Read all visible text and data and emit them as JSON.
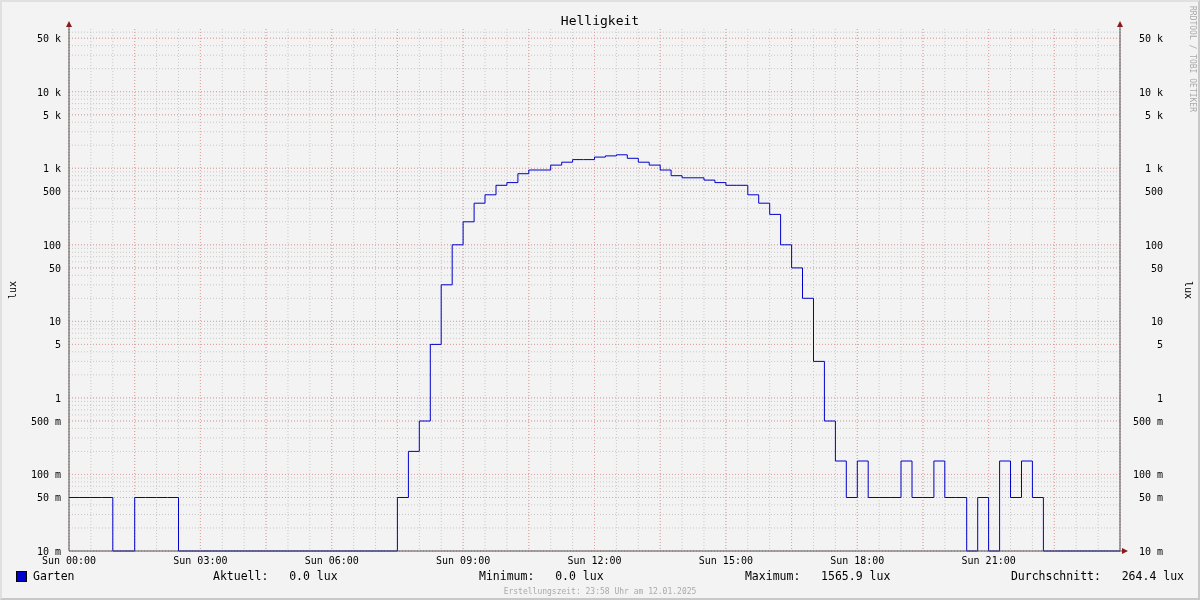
{
  "graph": {
    "title": "Helligkeit",
    "left_axis": {
      "label": "lux",
      "tick_labels": [
        "50 k",
        "10 k",
        "5 k",
        "1 k",
        "500",
        "100",
        "50",
        "10",
        "5",
        "1",
        "500 m",
        "100 m",
        "50 m",
        "10 m"
      ]
    },
    "right_axis": {
      "label": "lux",
      "tick_labels": [
        "50 k",
        "10 k",
        "5 k",
        "1 k",
        "500",
        "100",
        "50",
        "10",
        "5",
        "1",
        "500 m",
        "100 m",
        "50 m",
        "10 m"
      ]
    },
    "time_labels": [
      "Sun 00:00",
      "Sun 03:00",
      "Sun 06:00",
      "Sun 09:00",
      "Sun 12:00",
      "Sun 15:00",
      "Sun 18:00",
      "Sun 21:00"
    ],
    "series": {
      "name": "Garten",
      "color": "#0000cc"
    },
    "credit": "RRDTOOL / TOBI OETIKER"
  },
  "legend": {
    "stats": [
      {
        "label": "Aktuell:",
        "value": "0.0 lux"
      },
      {
        "label": "Minimum:",
        "value": "0.0 lux"
      },
      {
        "label": "Maximum:",
        "value": "1565.9 lux"
      },
      {
        "label": "Durchschnitt:",
        "value": "264.4 lux"
      }
    ]
  },
  "footer": "Erstellungszeit: 23:58 Uhr am 12.01.2025"
}
